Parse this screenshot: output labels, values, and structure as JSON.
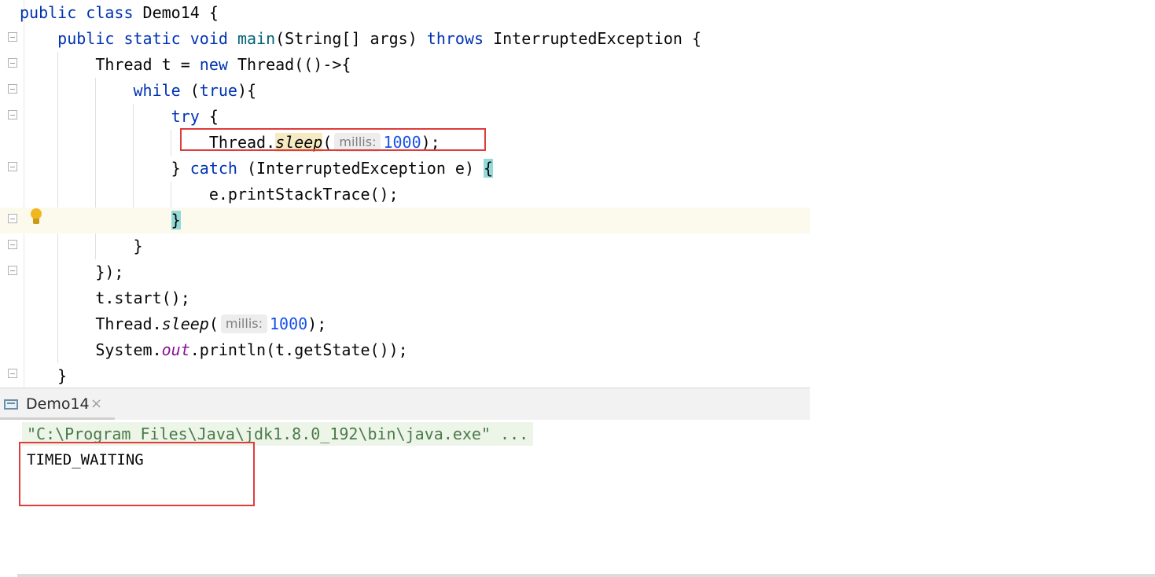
{
  "editor": {
    "lines": [
      {
        "parts": [
          [
            "kw",
            "public class "
          ],
          [
            "",
            "Demo14 {"
          ]
        ]
      },
      {
        "parts": [
          [
            "",
            "    "
          ],
          [
            "kw",
            "public static void "
          ],
          [
            "fn",
            "main"
          ],
          [
            "",
            "(String[] args) "
          ],
          [
            "kw",
            "throws "
          ],
          [
            "",
            "InterruptedException {"
          ]
        ]
      },
      {
        "parts": [
          [
            "",
            "        Thread t = "
          ],
          [
            "kw",
            "new "
          ],
          [
            "",
            "Thread(()->{"
          ]
        ]
      },
      {
        "parts": [
          [
            "",
            "            "
          ],
          [
            "kw",
            "while "
          ],
          [
            "",
            "("
          ],
          [
            "kw",
            "true"
          ],
          [
            "",
            "){"
          ]
        ]
      },
      {
        "parts": [
          [
            "",
            "                "
          ],
          [
            "kw",
            "try "
          ],
          [
            "",
            "{"
          ]
        ]
      },
      {
        "parts": [
          [
            "",
            "                    Thread."
          ],
          [
            "sleep-hl",
            "sleep"
          ],
          [
            "",
            "("
          ],
          [
            "hint",
            "millis:"
          ],
          [
            "num",
            "1000"
          ],
          [
            "",
            ");"
          ]
        ]
      },
      {
        "parts": [
          [
            "",
            "                } "
          ],
          [
            "kw",
            "catch "
          ],
          [
            "",
            "(InterruptedException e) "
          ],
          [
            "brace-match",
            "{"
          ]
        ]
      },
      {
        "parts": [
          [
            "",
            "                    e.printStackTrace();"
          ]
        ]
      },
      {
        "parts": [
          [
            "",
            "                "
          ],
          [
            "brace-match",
            "}"
          ]
        ],
        "highlight": true
      },
      {
        "parts": [
          [
            "",
            "            }"
          ]
        ]
      },
      {
        "parts": [
          [
            "",
            "        });"
          ]
        ]
      },
      {
        "parts": [
          [
            "",
            "        t.start();"
          ]
        ]
      },
      {
        "parts": [
          [
            "",
            "        Thread."
          ],
          [
            "static-m",
            "sleep"
          ],
          [
            "",
            "("
          ],
          [
            "hint",
            "millis:"
          ],
          [
            "num",
            "1000"
          ],
          [
            "",
            ");"
          ]
        ]
      },
      {
        "parts": [
          [
            "",
            "        System."
          ],
          [
            "field",
            "out"
          ],
          [
            "",
            ".println(t.getState());"
          ]
        ]
      },
      {
        "parts": [
          [
            "",
            "    }"
          ]
        ]
      }
    ]
  },
  "run_panel": {
    "tab_label": "Demo14",
    "close_glyph": "×",
    "command_line": "\"C:\\Program Files\\Java\\jdk1.8.0_192\\bin\\java.exe\" ...",
    "output": "TIMED_WAITING"
  },
  "icons": {
    "bulb": "intention-bulb-icon",
    "console": "console-icon",
    "close": "close-icon"
  },
  "colors": {
    "keyword": "#0033b3",
    "number": "#1750eb",
    "annotation_box": "#e03c3c",
    "brace_match": "#93d9d9",
    "current_line": "#fcfaed"
  }
}
